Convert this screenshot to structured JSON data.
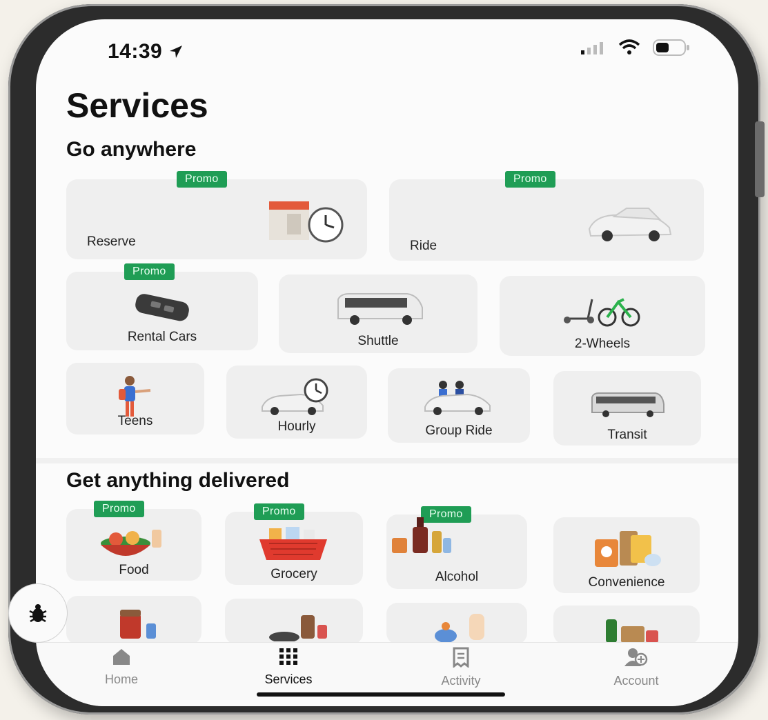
{
  "status_bar": {
    "time": "14:39"
  },
  "page": {
    "title": "Services"
  },
  "sections": {
    "go_anywhere": {
      "title": "Go anywhere",
      "tiles": [
        {
          "label": "Reserve",
          "promo": "Promo"
        },
        {
          "label": "Ride",
          "promo": "Promo"
        },
        {
          "label": "Rental Cars",
          "promo": "Promo"
        },
        {
          "label": "Shuttle"
        },
        {
          "label": "2-Wheels"
        },
        {
          "label": "Teens"
        },
        {
          "label": "Hourly"
        },
        {
          "label": "Group Ride"
        },
        {
          "label": "Transit"
        }
      ]
    },
    "delivered": {
      "title": "Get anything delivered",
      "tiles": [
        {
          "label": "Food",
          "promo": "Promo"
        },
        {
          "label": "Grocery",
          "promo": "Promo"
        },
        {
          "label": "Alcohol",
          "promo": "Promo"
        },
        {
          "label": "Convenience"
        }
      ]
    }
  },
  "tab_bar": {
    "items": [
      {
        "label": "Home",
        "icon": "home-icon"
      },
      {
        "label": "Services",
        "icon": "grid-icon",
        "active": true
      },
      {
        "label": "Activity",
        "icon": "receipt-icon"
      },
      {
        "label": "Account",
        "icon": "account-icon"
      }
    ]
  },
  "colors": {
    "promo_green": "#1f9d55",
    "tile_bg": "#efefef",
    "text": "#111111"
  }
}
